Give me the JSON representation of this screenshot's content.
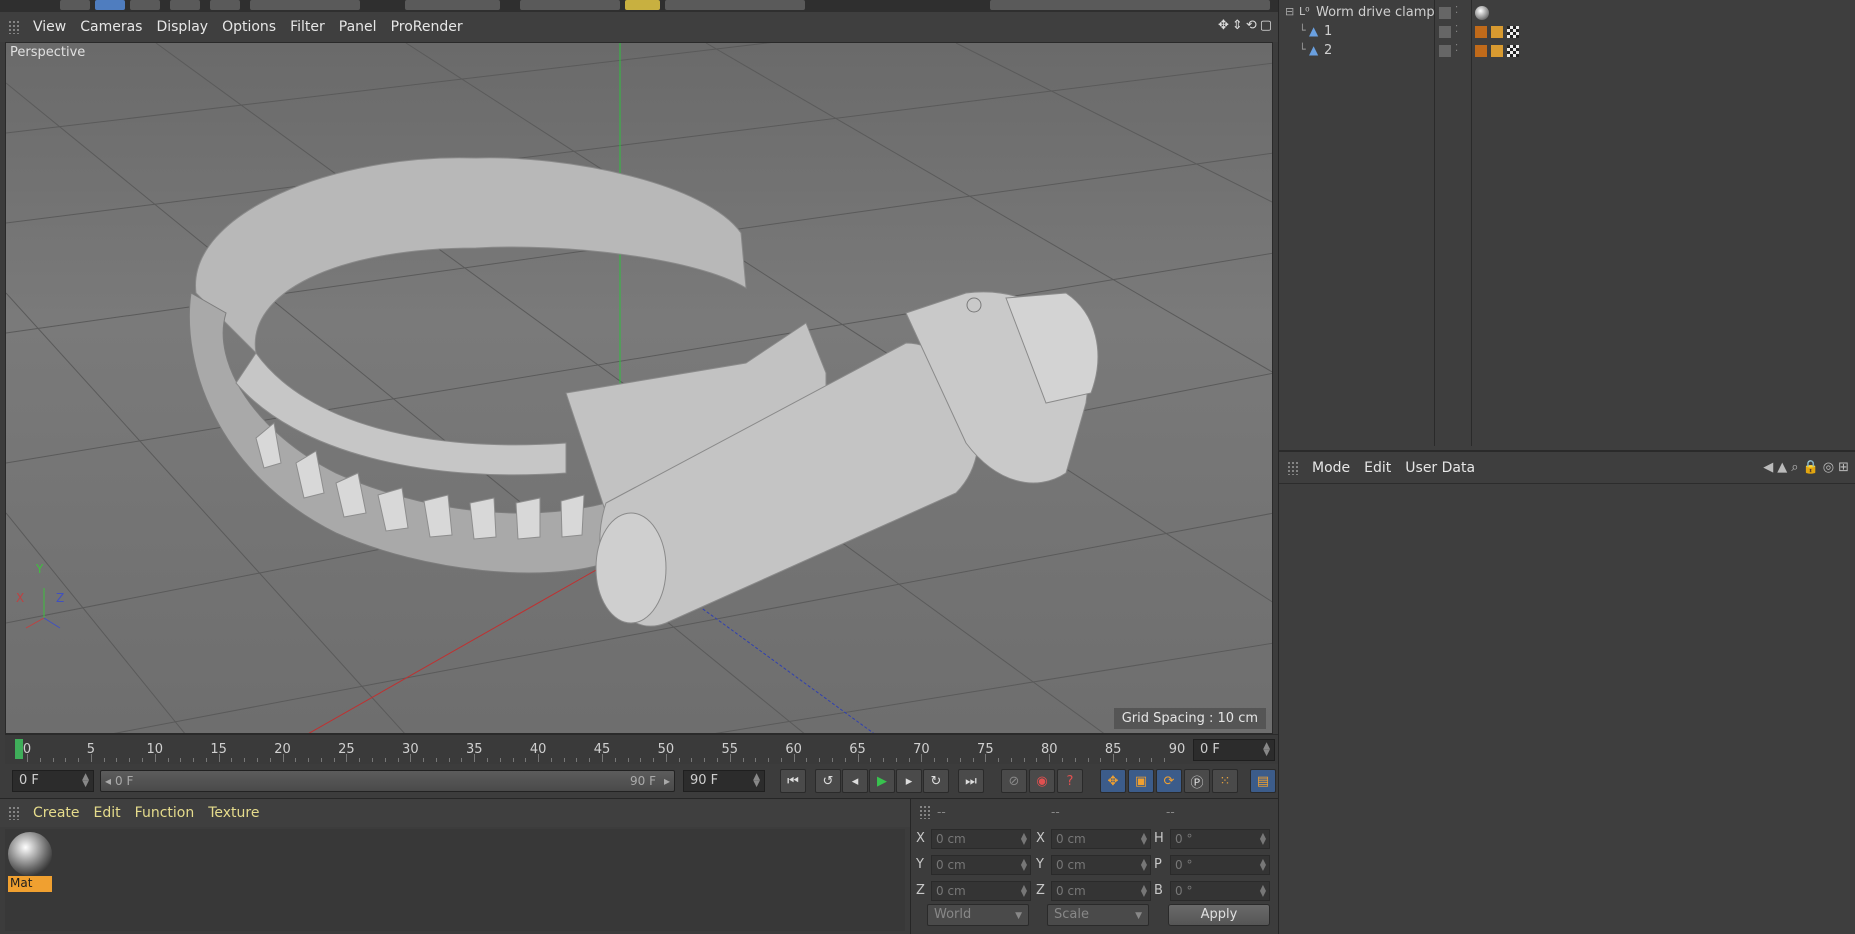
{
  "viewport": {
    "menu": [
      "View",
      "Cameras",
      "Display",
      "Options",
      "Filter",
      "Panel",
      "ProRender"
    ],
    "camera_label": "Perspective",
    "grid_spacing": "Grid Spacing : 10 cm",
    "axis_labels": {
      "x": "X",
      "y": "Y",
      "z": "Z"
    }
  },
  "timeline": {
    "ticks": [
      "0",
      "5",
      "10",
      "15",
      "20",
      "25",
      "30",
      "35",
      "40",
      "45",
      "50",
      "55",
      "60",
      "65",
      "70",
      "75",
      "80",
      "85",
      "90"
    ],
    "current_frame": "0 F"
  },
  "transport": {
    "start_field": "0 F",
    "range_start": "0 F",
    "range_end": "90 F",
    "end_field": "90 F"
  },
  "material_manager": {
    "menu": [
      "Create",
      "Edit",
      "Function",
      "Texture"
    ],
    "materials": [
      {
        "name": "Mat"
      }
    ]
  },
  "coordinates": {
    "headers": [
      "--",
      "--",
      "--"
    ],
    "rows": [
      {
        "pos_label": "X",
        "pos": "0 cm",
        "size_label": "X",
        "size": "0 cm",
        "rot_label": "H",
        "rot": "0 °"
      },
      {
        "pos_label": "Y",
        "pos": "0 cm",
        "size_label": "Y",
        "size": "0 cm",
        "rot_label": "P",
        "rot": "0 °"
      },
      {
        "pos_label": "Z",
        "pos": "0 cm",
        "size_label": "Z",
        "size": "0 cm",
        "rot_label": "B",
        "rot": "0 °"
      }
    ],
    "space_dropdown": "World",
    "mode_dropdown": "Scale",
    "apply_label": "Apply"
  },
  "object_manager": {
    "objects": [
      {
        "name": "Worm drive clamp"
      },
      {
        "name": "1"
      },
      {
        "name": "2"
      }
    ]
  },
  "attribute_manager": {
    "menu": [
      "Mode",
      "Edit",
      "User Data"
    ]
  },
  "colors": {
    "accent": "#e6dc8c",
    "selection": "#f0a030",
    "playhead": "#3fae5a"
  }
}
